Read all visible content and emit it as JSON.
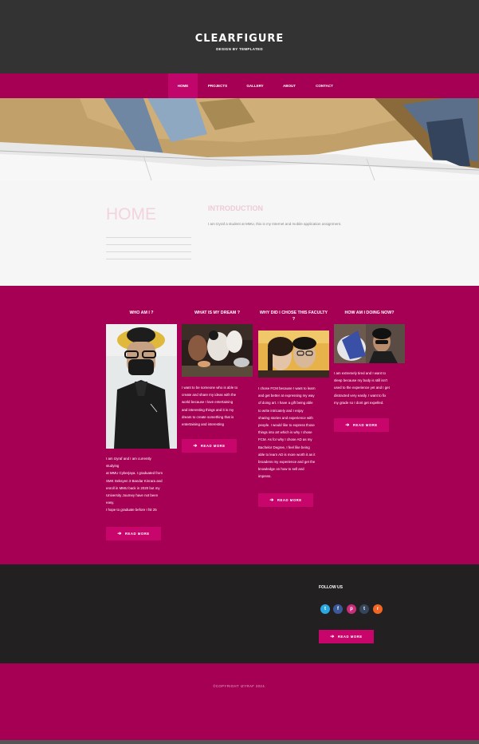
{
  "header": {
    "logo": "CLEARFIGURE",
    "tagline": "DESIGN BY TEMPLATED"
  },
  "nav": {
    "items": [
      {
        "label": "HOME",
        "active": true
      },
      {
        "label": "PROJECTS"
      },
      {
        "label": "GALLERY"
      },
      {
        "label": "ABOUT"
      },
      {
        "label": "CONTACT"
      }
    ]
  },
  "intro": {
    "title": "HOME",
    "heading": "INTRODUCTION",
    "text": "I am Izyraf a student at MMU, this is my Internet and mobile application assignment."
  },
  "features": {
    "columns": [
      {
        "title": "WHO AM I ?",
        "text": [
          "I am Izyraf and I am currently",
          "studying",
          "at MMU Cyberjaya. I graduated from",
          "SMK Seksyen 3 Bandar Kinrara and",
          "enroll in MMU back in 2020 but my",
          "University Journey have not been",
          "easy.",
          "I hope to graduate before I hit 25"
        ],
        "button": "READ MORE"
      },
      {
        "title": "WHAT IS MY DREAM ?",
        "text": [
          "I want to be someone who is able to",
          "create and share my ideas with the",
          "world because I love entertaining",
          "and interesting things and it is my",
          "dream to create something that is",
          "entertaining and interesting"
        ],
        "button": "READ MORE"
      },
      {
        "title": "WHY DID I CHOSE THIS FACULTY ?",
        "text": [
          "I chose FCM because I want to learn",
          "and get better at expressing my way",
          "of doing art. I have a gift being able",
          "to write intricately and I enjoy",
          "sharing stories and experience with",
          "people. I would like to express those",
          "things into art which is why I chose",
          "FCM. As for why I chose AD as my",
          "Bachelor Degree, I feel like being",
          "able to learn AD is more worth it as it",
          "broadens my experience and get the",
          "knowledge on how to sell and",
          "impress."
        ],
        "button": "READ MORE"
      },
      {
        "title": "HOW AM I DOING NOW?",
        "text": [
          "I am extremely tired and I want to",
          "sleep because my body is still isn't",
          "used to the experience yet and I get",
          "distracted very easily. I want to fix",
          "my grade so I dont get expelled."
        ],
        "button": "READ MORE"
      }
    ]
  },
  "footer": {
    "follow": "FOLLOW US",
    "social": [
      {
        "name": "twitter",
        "glyph": "t",
        "color": "#2aa9e0"
      },
      {
        "name": "facebook",
        "glyph": "f",
        "color": "#3b5998"
      },
      {
        "name": "pinterest",
        "glyph": "p",
        "color": "#c92c7a"
      },
      {
        "name": "tumblr",
        "glyph": "t",
        "color": "#35465c"
      },
      {
        "name": "rss",
        "glyph": "r",
        "color": "#f26522"
      }
    ],
    "button": "READ MORE",
    "copyright": "©COPYRIGHT IZYRAF 2024."
  }
}
